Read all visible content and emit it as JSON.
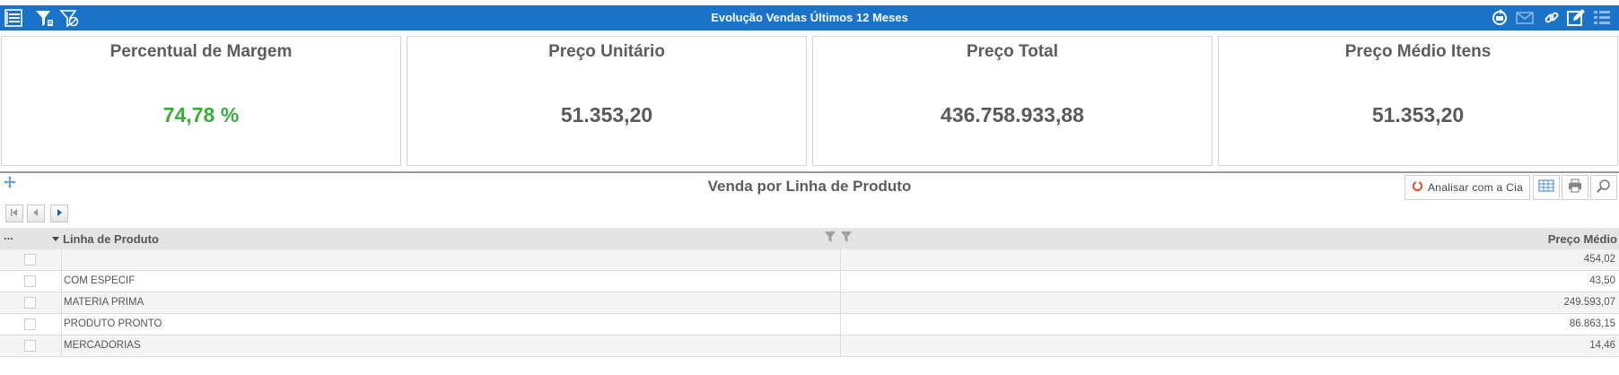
{
  "header": {
    "title": "Evolução Vendas Últimos 12 Meses",
    "left_icons": [
      "list-view-icon",
      "filter-icon",
      "filter-clear-icon"
    ],
    "right_icons": [
      "refresh-icon",
      "mail-icon",
      "link-icon",
      "edit-icon",
      "menu-icon"
    ]
  },
  "kpis": [
    {
      "title": "Percentual de Margem",
      "value": "74,78 %",
      "value_color": "#3aae3a"
    },
    {
      "title": "Preço Unitário",
      "value": "51.353,20"
    },
    {
      "title": "Preço Total",
      "value": "436.758.933,88"
    },
    {
      "title": "Preço Médio Itens",
      "value": "51.353,20"
    }
  ],
  "grid": {
    "title": "Venda por Linha de Produto",
    "analyze_label": "Analisar com a Cia",
    "columns": {
      "menu": "...",
      "product_line": "Linha de Produto",
      "avg_price": "Preço Médio"
    },
    "rows": [
      {
        "line": "",
        "avg_price": "454,02"
      },
      {
        "line": "COM ESPECIF",
        "avg_price": "43,50"
      },
      {
        "line": "MATERIA PRIMA",
        "avg_price": "249.593,07"
      },
      {
        "line": "PRODUTO PRONTO",
        "avg_price": "86.863,15"
      },
      {
        "line": "MERCADORIAS",
        "avg_price": "14,46"
      }
    ]
  },
  "colors": {
    "header_bg": "#1a73c9",
    "positive": "#3aae3a",
    "table_header_bg": "#e4e4e4"
  }
}
